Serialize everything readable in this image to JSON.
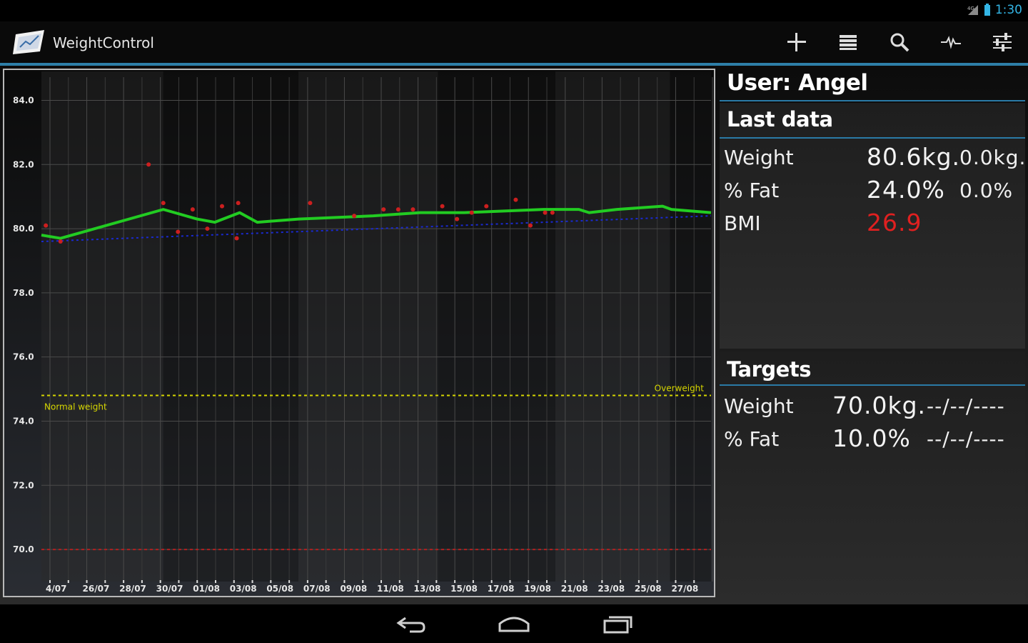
{
  "statusbar": {
    "time": "1:30"
  },
  "app": {
    "title": "WeightControl"
  },
  "toolbar": [
    "add-icon",
    "list-icon",
    "search-icon",
    "pulse-icon",
    "settings-sliders-icon"
  ],
  "panel": {
    "user_heading": "User: Angel",
    "last_data": {
      "heading": "Last data",
      "rows": [
        {
          "label": "Weight",
          "value": "80.6kg.",
          "value2": "0.0kg."
        },
        {
          "label": "% Fat",
          "value": "24.0%",
          "value2": "0.0%"
        },
        {
          "label": "BMI",
          "value": "26.9",
          "value2": ""
        }
      ],
      "bmi_color": "#e02020"
    },
    "targets": {
      "heading": "Targets",
      "rows": [
        {
          "label": "Weight",
          "value": "70.0kg.",
          "value2": "--/--/----"
        },
        {
          "label": "% Fat",
          "value": "10.0%",
          "value2": "--/--/----"
        }
      ]
    }
  },
  "chart_data": {
    "type": "line",
    "ylim": [
      69.0,
      84.5
    ],
    "y_ticks": [
      "84.0",
      "82.0",
      "80.0",
      "78.0",
      "76.0",
      "74.0",
      "72.0",
      "70.0"
    ],
    "x_tick_labels": [
      "4/07",
      "26/07",
      "28/07",
      "30/07",
      "01/08",
      "03/08",
      "05/08",
      "07/08",
      "09/08",
      "11/08",
      "13/08",
      "15/08",
      "17/08",
      "19/08",
      "21/08",
      "23/08",
      "25/08",
      "27/08"
    ],
    "annotations": {
      "overweight": "Overweight",
      "normal": "Normal weight"
    },
    "reference_lines": [
      {
        "name": "overweight",
        "y": 74.8,
        "color": "#d6d600"
      },
      {
        "name": "target",
        "y": 70.0,
        "color": "#b02020"
      }
    ],
    "series": [
      {
        "name": "trend",
        "color": "#22cc22",
        "x": [
          0,
          1.3,
          8.3,
          10.6,
          11.8,
          13.5,
          14.7,
          17.5,
          22.6,
          25.8,
          28.8,
          34.2,
          36.6,
          37.3,
          39.2,
          42.3,
          42.9,
          45.6
        ],
        "y": [
          79.8,
          79.7,
          80.6,
          80.3,
          80.2,
          80.5,
          80.2,
          80.3,
          80.4,
          80.5,
          80.5,
          80.6,
          80.6,
          80.5,
          80.6,
          80.7,
          80.6,
          80.5
        ]
      },
      {
        "name": "average",
        "color": "#1a2ad0",
        "x": [
          0,
          45.6
        ],
        "y": [
          79.6,
          80.4
        ]
      },
      {
        "name": "measurements",
        "color": "#cc1f1f",
        "x": [
          0.3,
          1.3,
          7.3,
          8.3,
          9.3,
          10.3,
          11.3,
          12.3,
          13.3,
          13.4,
          18.3,
          21.3,
          23.3,
          24.3,
          25.3,
          27.3,
          28.3,
          29.3,
          30.3,
          32.3,
          33.3,
          34.3,
          34.8
        ],
        "y": [
          80.1,
          79.6,
          82.0,
          80.8,
          79.9,
          80.6,
          80.0,
          80.7,
          79.7,
          80.8,
          80.8,
          80.4,
          80.6,
          80.6,
          80.6,
          80.7,
          80.3,
          80.5,
          80.7,
          80.9,
          80.1,
          80.5,
          80.5
        ]
      }
    ]
  }
}
